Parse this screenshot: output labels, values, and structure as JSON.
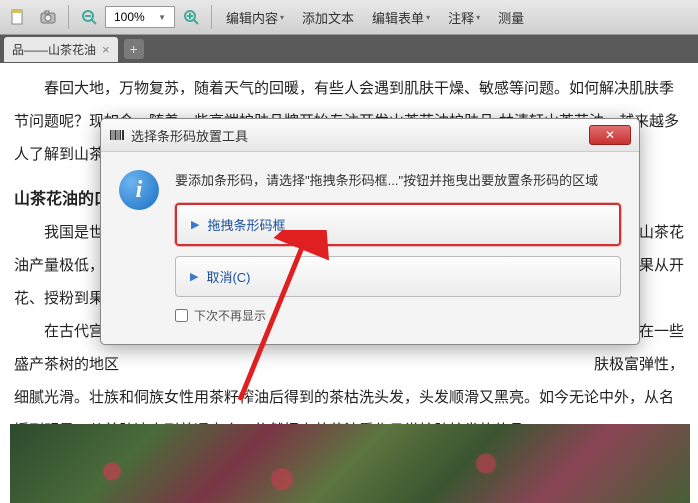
{
  "toolbar": {
    "zoom_value": "100%",
    "menu": [
      "编辑内容",
      "添加文本",
      "编辑表单",
      "注释",
      "测量"
    ]
  },
  "tab": {
    "title": "品——山茶花油",
    "close": "×",
    "add": "+"
  },
  "document": {
    "p1": "春回大地，万物复苏，随着天气的回暖，有些人会遇到肌肤干燥、敏感等问题。如何解决肌肤季节问题呢？现如今，随着一些高端护肤品牌开始专注开发山茶花油护肤品-林清轩山茶花油，越来越多人了解到山茶花油的保湿滋养功效。",
    "h1": "山茶花油的口",
    "p2": "我国是世界",
    "p2b": "不过山茶花",
    "p3": "油产量极低，素",
    "p3b": "到山茶果从开",
    "p4": "花、授粉到果实",
    "p5": "在古代宫廷",
    "p5b": "疗效。在一些",
    "p6": "盛产茶树的地区",
    "p6b": "肤极富弹性，",
    "p7": "细腻光滑。壮族和侗族女性用茶籽榨油后得到的茶枯洗头发，头发顺滑又黑亮。如今无论中外，从名媛到明星，从美肤达人到普通大众，依然把山茶花油看作日常护肤护发的佳品。"
  },
  "dialog": {
    "title": "选择条形码放置工具",
    "message": "要添加条形码，请选择\"拖拽条形码框...\"按钮并拖曳出要放置条形码的区域",
    "btn1": "拖拽条形码框",
    "btn2": "取消(C)",
    "checkbox": "下次不再显示",
    "close": "✕"
  }
}
